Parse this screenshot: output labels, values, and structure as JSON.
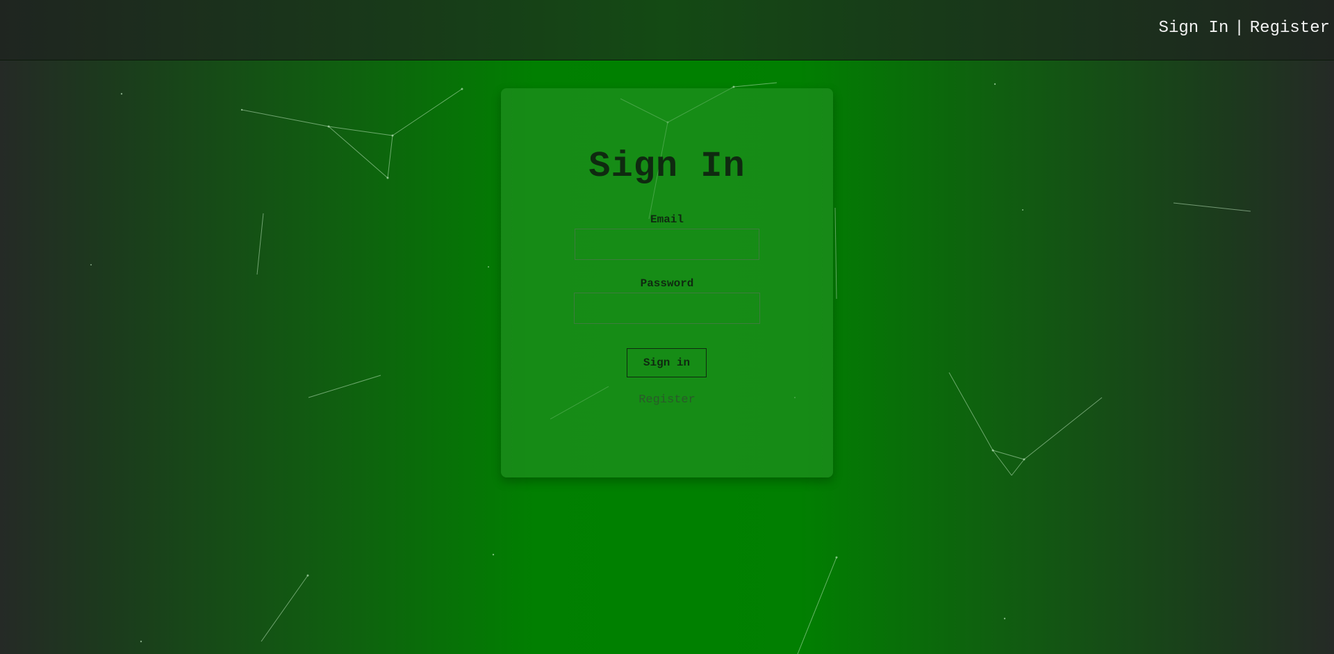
{
  "nav": {
    "sign_in_label": "Sign In",
    "separator": "|",
    "register_label": "Register"
  },
  "form": {
    "title": "Sign In",
    "email_label": "Email",
    "email_value": "",
    "password_label": "Password",
    "password_value": "",
    "submit_label": "Sign in",
    "register_label": "Register"
  },
  "colors": {
    "accent_green": "#008000",
    "dark_edge": "#252a26",
    "card_text": "#0f2a10",
    "link_muted": "#2a5a2a"
  }
}
